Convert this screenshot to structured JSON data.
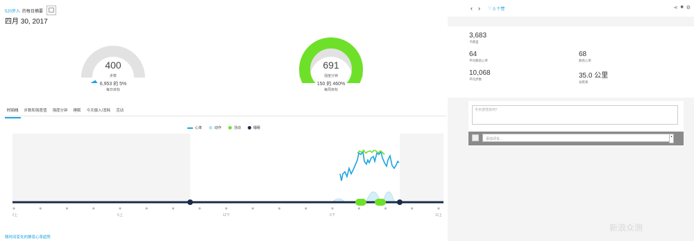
{
  "header": {
    "link1": "520步入",
    "link2": "的每日摘要",
    "date": "四月 30, 2017"
  },
  "gauges": [
    {
      "value": "400",
      "label": "步数",
      "sub": "6,953 的 5%",
      "sub2": "每日目标",
      "fraction": 0.05,
      "color": "#1aa3e0"
    },
    {
      "value": "691",
      "label": "强度分钟",
      "sub": "150 的 460%",
      "sub2": "每周目标",
      "fraction": 1.0,
      "color": "#6ee02a"
    }
  ],
  "tabs": [
    "时间线",
    "步数和强度值",
    "强度分钟",
    "睡眠",
    "今天摄入/消耗",
    "活动"
  ],
  "legend": [
    {
      "label": "心率",
      "color": "#1aa3e0",
      "kind": "line"
    },
    {
      "label": "动作",
      "color": "#b9e0f2",
      "kind": "dot"
    },
    {
      "label": "活动",
      "color": "#6ee02a",
      "kind": "dot"
    },
    {
      "label": "睡眠",
      "color": "#1b2b4a",
      "kind": "dot"
    }
  ],
  "chart_data": {
    "type": "line",
    "x_ticks": [
      "12上",
      "",
      "",
      "",
      "6上",
      "",
      "",
      "",
      "12下",
      "",
      "",
      "",
      "6下",
      "",
      "",
      "",
      "12上"
    ],
    "heart_rate_segment": "afternoon-evening"
  },
  "bottom_link": "随时间变化的静息心率趋势",
  "right": {
    "likes": "0 个赞",
    "stats": [
      {
        "value": "3,683",
        "label": "卡路里"
      },
      {
        "value": "64",
        "label": "平均静息心率"
      },
      {
        "value": "68",
        "label": "静息心率"
      },
      {
        "value": "10,068",
        "label": "平均步数"
      },
      {
        "value": "35.0 公里",
        "label": "总距离"
      }
    ],
    "notes_placeholder": "今天感觉如何？",
    "comment_placeholder": "添加评论..."
  },
  "colors": {
    "accent": "#1aa3e0",
    "green": "#6ee02a",
    "navy": "#1b2b4a"
  },
  "watermark": "新浪众测"
}
